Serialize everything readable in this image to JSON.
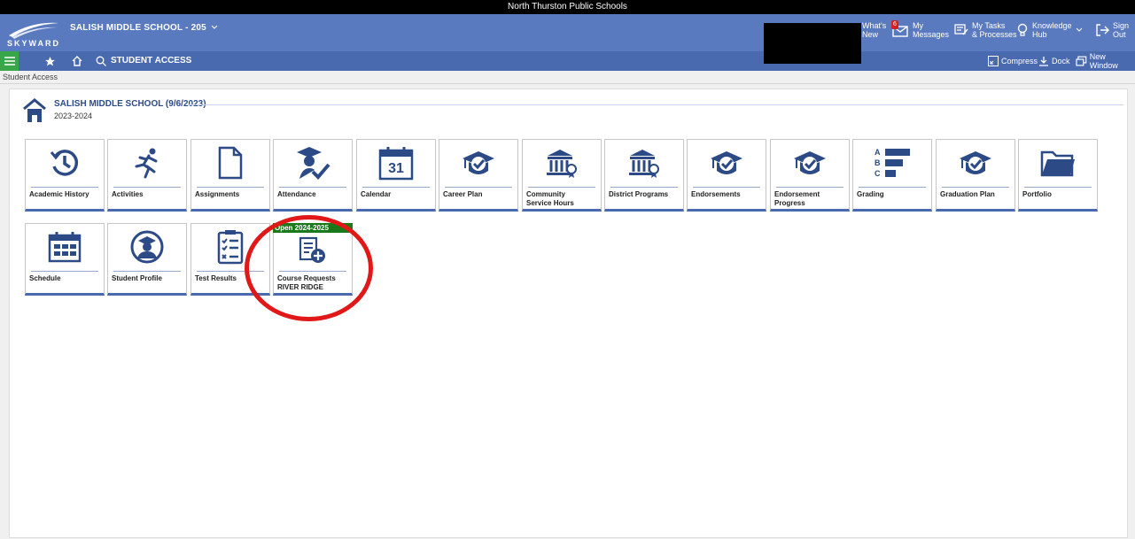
{
  "topbar": {
    "district": "North Thurston Public Schools"
  },
  "header": {
    "logo_text": "SKYWARD",
    "school_title": "SALISH MIDDLE SCHOOL - 205",
    "whats_new": "What's\nNew",
    "messages_count": "6",
    "my_messages": "My\nMessages",
    "my_tasks": "My Tasks\n& Processes",
    "knowledge_hub": "Knowledge\nHub",
    "sign_out": "Sign\nOut"
  },
  "navbar": {
    "title": "STUDENT ACCESS",
    "compress": "Compress",
    "dock": "Dock",
    "new_window": "New Window"
  },
  "breadcrumb": "Student Access",
  "section": {
    "title": "SALISH MIDDLE SCHOOL (9/6/2023)",
    "year": "2023-2024"
  },
  "tiles_row1": [
    {
      "label": "Academic History",
      "icon": "history-icon"
    },
    {
      "label": "Activities",
      "icon": "running-person-icon"
    },
    {
      "label": "Assignments",
      "icon": "document-icon"
    },
    {
      "label": "Attendance",
      "icon": "graduate-check-icon"
    },
    {
      "label": "Calendar",
      "icon": "calendar-icon",
      "day": "31"
    },
    {
      "label": "Career Plan",
      "icon": "cap-check-icon"
    },
    {
      "label": "Community Service Hours",
      "icon": "building-award-icon"
    },
    {
      "label": "District Programs",
      "icon": "building-award-icon"
    },
    {
      "label": "Endorsements",
      "icon": "cap-check-icon"
    },
    {
      "label": "Endorsement Progress",
      "icon": "cap-check-icon"
    },
    {
      "label": "Grading",
      "icon": "grades-icon",
      "letters": [
        "A",
        "B",
        "C"
      ]
    },
    {
      "label": "Graduation Plan",
      "icon": "cap-check-icon"
    },
    {
      "label": "Portfolio",
      "icon": "folder-icon"
    }
  ],
  "tiles_row2": [
    {
      "label": "Schedule",
      "icon": "schedule-icon"
    },
    {
      "label": "Student Profile",
      "icon": "student-profile-icon"
    },
    {
      "label": "Test Results",
      "icon": "checklist-icon"
    },
    {
      "label": "Course Requests\nRIVER RIDGE",
      "icon": "add-request-icon",
      "banner": "Open 2024-2025"
    }
  ],
  "colors": {
    "header": "#5a7abf",
    "nav": "#4a6ab0",
    "accent": "#2c4a85",
    "banner": "#1a7a1a",
    "highlight": "#e01818"
  }
}
